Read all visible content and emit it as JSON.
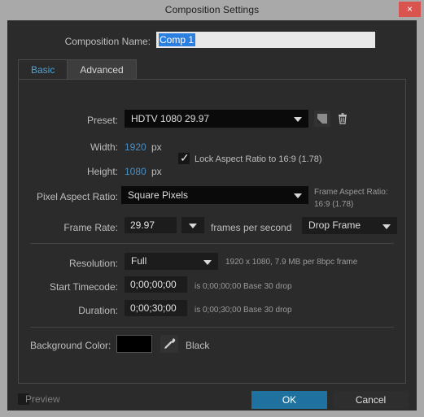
{
  "window": {
    "title": "Composition Settings",
    "close_label": "×"
  },
  "comp_name": {
    "label": "Composition Name:",
    "value": "Comp 1",
    "placeholder": "Comp 1"
  },
  "tabs": [
    {
      "label": "Basic",
      "active": true
    },
    {
      "label": "Advanced",
      "active": false
    }
  ],
  "preset": {
    "label": "Preset:",
    "value": "HDTV 1080 29.97",
    "save_icon": "save-preset-icon",
    "delete_icon": "trash-icon"
  },
  "width": {
    "label": "Width:",
    "value": "1920",
    "units": "px"
  },
  "height": {
    "label": "Height:",
    "value": "1080",
    "units": "px"
  },
  "lock_aspect": {
    "label": "Lock Aspect Ratio to 16:9 (1.78)",
    "checked": true
  },
  "pixel_aspect": {
    "label": "Pixel Aspect Ratio:",
    "value": "Square Pixels"
  },
  "frame_aspect": {
    "label": "Frame Aspect Ratio:",
    "value": "16:9 (1.78)"
  },
  "frame_rate": {
    "label": "Frame Rate:",
    "value": "29.97",
    "units": "frames per second",
    "drop_mode": "Drop Frame"
  },
  "resolution": {
    "label": "Resolution:",
    "value": "Full",
    "hint": "1920 x 1080, 7.9 MB per 8bpc frame"
  },
  "start_timecode": {
    "label": "Start Timecode:",
    "value": "0;00;00;00",
    "hint": "is 0;00;00;00  Base 30  drop"
  },
  "duration": {
    "label": "Duration:",
    "value": "0;00;30;00",
    "hint": "is 0;00;30;00  Base 30  drop"
  },
  "background_color": {
    "label": "Background Color:",
    "swatch_hex": "#000000",
    "eyedropper_icon": "eyedropper-icon",
    "name": "Black"
  },
  "footer": {
    "preview_label": "Preview",
    "preview_checked": false,
    "ok_label": "OK",
    "cancel_label": "Cancel"
  },
  "colors": {
    "accent": "#1f72a0",
    "hot_text": "#4a8fc4",
    "tab_active_text": "#4ea3d8",
    "close_button": "#d9534f",
    "dialog_bg": "#2b2b2b",
    "chrome": "#a9a9a9"
  }
}
